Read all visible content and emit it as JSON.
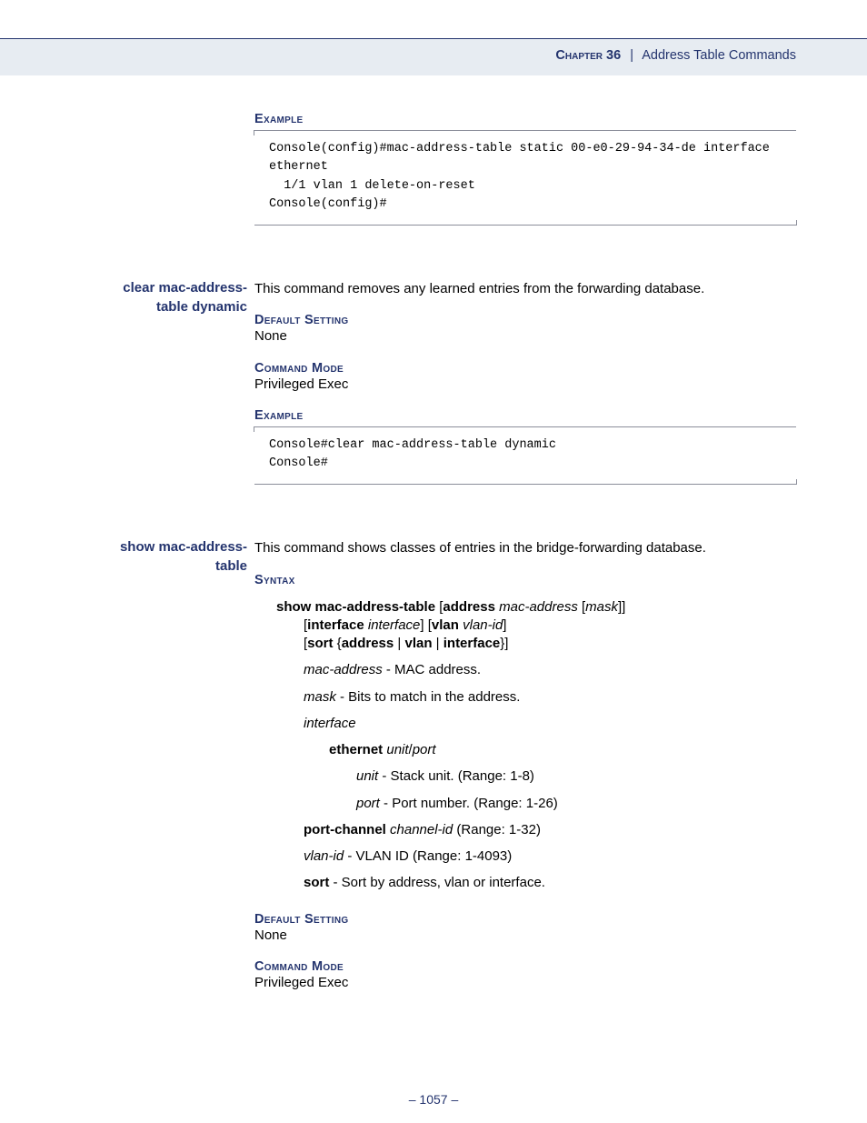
{
  "header": {
    "chapter_label": "Chapter 36",
    "section_title": "Address Table Commands"
  },
  "sec1": {
    "example_label": "Example",
    "code": "Console(config)#mac-address-table static 00-e0-29-94-34-de interface ethernet \n  1/1 vlan 1 delete-on-reset\nConsole(config)#"
  },
  "sec2": {
    "margin_title_l1": "clear mac-address-",
    "margin_title_l2": "table dynamic",
    "intro": "This command removes any learned entries from the forwarding database.",
    "default_label": "Default Setting",
    "default_value": "None",
    "mode_label": "Command Mode",
    "mode_value": "Privileged Exec",
    "example_label": "Example",
    "code": "Console#clear mac-address-table dynamic\nConsole#"
  },
  "sec3": {
    "margin_title_l1": "show mac-address-",
    "margin_title_l2": "table",
    "intro": "This command shows classes of entries in the bridge-forwarding database.",
    "syntax_label": "Syntax",
    "syntax": {
      "l1_b1": "show mac-address-table",
      "l1_open": " [",
      "l1_b2": "address",
      "l1_i1": " mac-address",
      "l1_open2": " [",
      "l1_i2": "mask",
      "l1_close": "]]",
      "l2_open": "[",
      "l2_b1": "interface",
      "l2_i1": " interface",
      "l2_mid": "] [",
      "l2_b2": "vlan",
      "l2_i2": " vlan-id",
      "l2_close": "]",
      "l3_open": "[",
      "l3_b1": "sort",
      "l3_brace_open": " {",
      "l3_b2": "address",
      "l3_bar": " | ",
      "l3_b3": "vlan",
      "l3_b4": "interface",
      "l3_close": "}]"
    },
    "params": {
      "mac_term": "mac-address",
      "mac_desc": " - MAC address.",
      "mask_term": "mask",
      "mask_desc": " - Bits to match in the address.",
      "iface_term": "interface",
      "eth_b": "ethernet",
      "eth_i": " unit",
      "eth_slash": "/",
      "eth_i2": "port",
      "unit_term": "unit",
      "unit_desc": " - Stack unit. (Range: 1-8)",
      "port_term": "port",
      "port_desc": " - Port number. (Range: 1-26)",
      "pc_b": "port-channel",
      "pc_i": " channel-id",
      "pc_desc": " (Range: 1-32)",
      "vlan_term": "vlan-id",
      "vlan_desc": " - VLAN ID (Range: 1-4093)",
      "sort_b": "sort",
      "sort_desc": " - Sort by address, vlan or interface."
    },
    "default_label": "Default Setting",
    "default_value": "None",
    "mode_label": "Command Mode",
    "mode_value": "Privileged Exec"
  },
  "footer": {
    "page": "– 1057 –"
  }
}
